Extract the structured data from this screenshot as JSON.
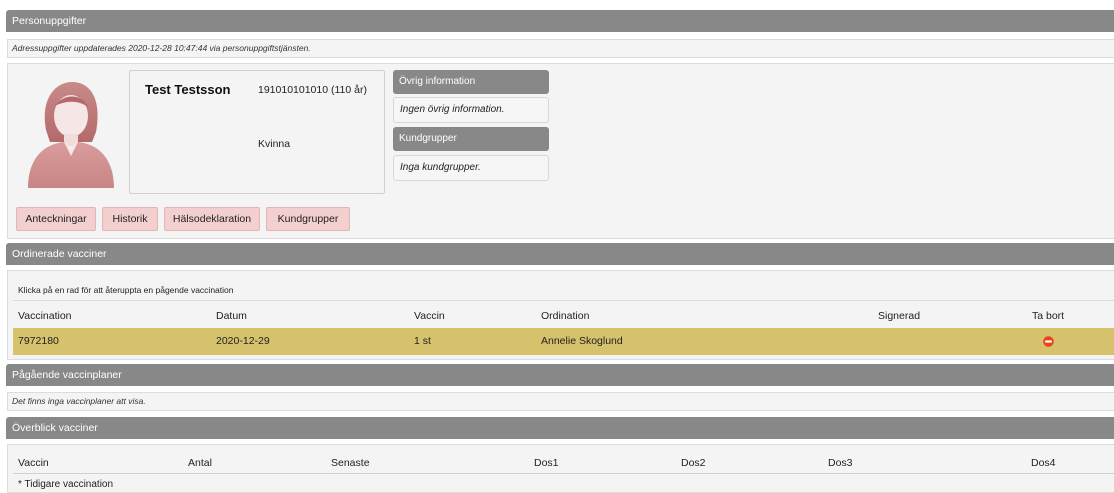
{
  "personuppgifter": {
    "header": "Personuppgifter",
    "note": "Adressuppgifter uppdaterades 2020-12-28 10:47:44 via personuppgiftstjänsten.",
    "name": "Test Testsson",
    "id": "191010101010 (110 år)",
    "gender": "Kvinna",
    "other_info_title": "Övrig information",
    "other_info_text": "Ingen övrig information.",
    "customer_groups_title": "Kundgrupper",
    "customer_groups_text": "Inga kundgrupper.",
    "buttons": [
      "Anteckningar",
      "Historik",
      "Hälsodeklaration",
      "Kundgrupper"
    ],
    "avatar_icon": "female-user-avatar-icon"
  },
  "ordinerade": {
    "header": "Ordinerade vacciner",
    "hint": "Klicka på en rad för att återuppta en pågende vaccination",
    "columns": [
      "Vaccination",
      "Datum",
      "Vaccin",
      "Ordination",
      "Signerad",
      "Ta bort"
    ],
    "rows": [
      {
        "vaccination": "7972180",
        "datum": "2020-12-29",
        "vaccin": "1 st",
        "ordination": "Annelie Skoglund",
        "signerad": ""
      }
    ],
    "row_color": "#d6c26c",
    "delete_icon": "remove-icon"
  },
  "pagaende": {
    "header": "Pågående vaccinplaner",
    "note": "Det finns inga vaccinplaner att visa."
  },
  "overblick": {
    "header": "Överblick vacciner",
    "columns": [
      "Vaccin",
      "Antal",
      "Senaste",
      "Dos1",
      "Dos2",
      "Dos3",
      "Dos4"
    ],
    "footnote": "* Tidigare vaccination"
  }
}
